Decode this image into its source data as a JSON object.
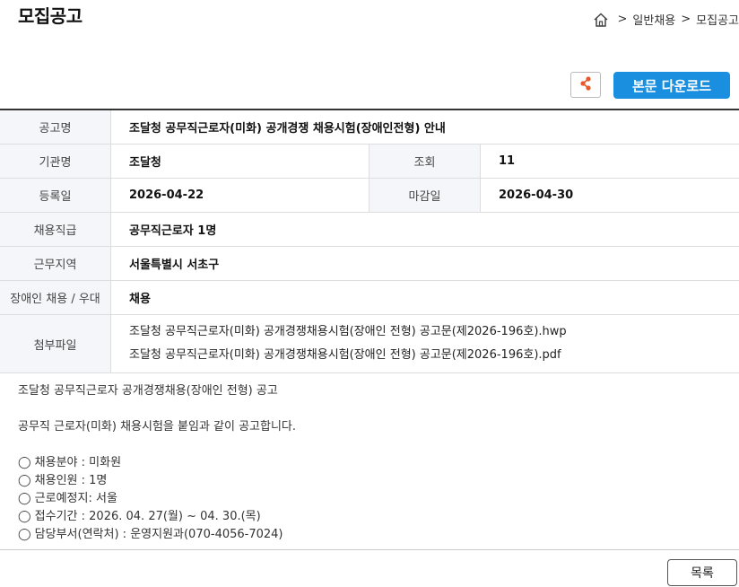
{
  "page": {
    "title": "모집공고"
  },
  "breadcrumb": {
    "items": [
      "일반채용",
      "모집공고"
    ],
    "separator": ">"
  },
  "toolbar": {
    "download_label": "본문 다운로드"
  },
  "info": {
    "title_label": "공고명",
    "title_value": "조달청 공무직근로자(미화) 공개경쟁 채용시험(장애인전형) 안내",
    "agency_label": "기관명",
    "agency_value": "조달청",
    "views_label": "조회",
    "views_value": "11",
    "reg_label": "등록일",
    "reg_value": "2026-04-22",
    "deadline_label": "마감일",
    "deadline_value": "2026-04-30",
    "position_label": "채용직급",
    "position_value": "공무직근로자 1명",
    "region_label": "근무지역",
    "region_value": "서울특별시 서초구",
    "disabled_label": "장애인 채용 / 우대",
    "disabled_value": "채용",
    "files_label": "첨부파일",
    "files": [
      "조달청 공무직근로자(미화) 공개경쟁채용시험(장애인 전형) 공고문(제2026-196호).hwp",
      "조달청 공무직근로자(미화) 공개경쟁채용시험(장애인 전형) 공고문(제2026-196호).pdf"
    ]
  },
  "content": {
    "heading": "조달청 공무직근로자 공개경쟁채용(장애인 전형) 공고",
    "intro": "공무직 근로자(미화) 채용시험을 붙임과 같이 공고합니다.",
    "items": [
      "◯ 채용분야 : 미화원",
      "◯ 채용인원 : 1명",
      "◯ 근로예정지: 서울",
      "◯ 접수기간 : 2026. 04. 27(월) ~ 04. 30.(목)",
      "◯ 담당부서(연락처) : 운영지원과(070-4056-7024)"
    ]
  },
  "footer": {
    "list_label": "목록"
  },
  "colors": {
    "accent": "#1a8fe0",
    "share_icon": "#e8572a"
  }
}
